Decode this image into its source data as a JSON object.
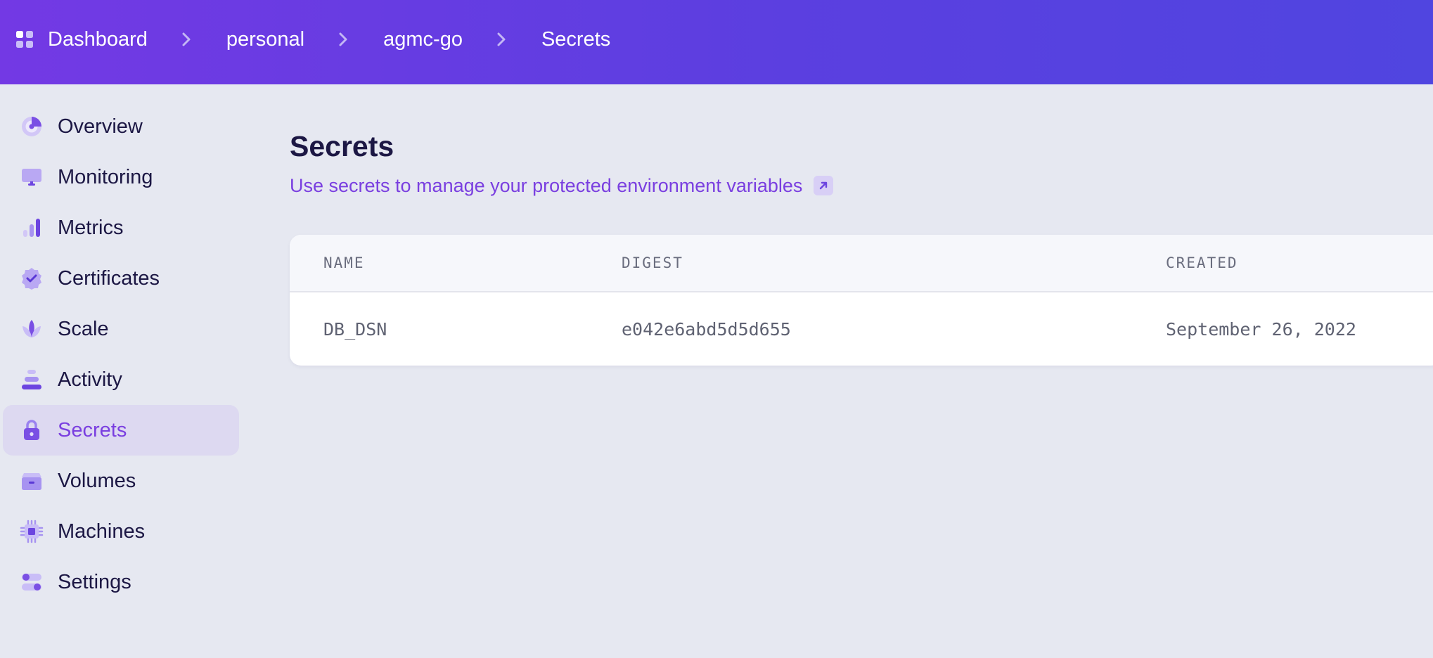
{
  "breadcrumb": {
    "items": [
      "Dashboard",
      "personal",
      "agmc-go",
      "Secrets"
    ]
  },
  "sidebar": {
    "items": [
      {
        "label": "Overview",
        "icon": "overview-icon"
      },
      {
        "label": "Monitoring",
        "icon": "monitor-icon"
      },
      {
        "label": "Metrics",
        "icon": "metrics-icon"
      },
      {
        "label": "Certificates",
        "icon": "certificate-icon"
      },
      {
        "label": "Scale",
        "icon": "scale-icon"
      },
      {
        "label": "Activity",
        "icon": "activity-icon"
      },
      {
        "label": "Secrets",
        "icon": "lock-icon",
        "active": true
      },
      {
        "label": "Volumes",
        "icon": "volume-icon"
      },
      {
        "label": "Machines",
        "icon": "chip-icon"
      },
      {
        "label": "Settings",
        "icon": "settings-toggle-icon"
      }
    ]
  },
  "main": {
    "title": "Secrets",
    "subtitle": "Use secrets to manage your protected environment variables"
  },
  "table": {
    "columns": [
      "NAME",
      "DIGEST",
      "CREATED"
    ],
    "rows": [
      {
        "name": "DB_DSN",
        "digest": "e042e6abd5d5d655",
        "created": "September 26, 2022"
      }
    ]
  },
  "colors": {
    "header_gradient_start": "#7339e4",
    "header_gradient_end": "#5045e0",
    "accent": "#7a3fe0",
    "page_background": "#e6e8f1"
  }
}
